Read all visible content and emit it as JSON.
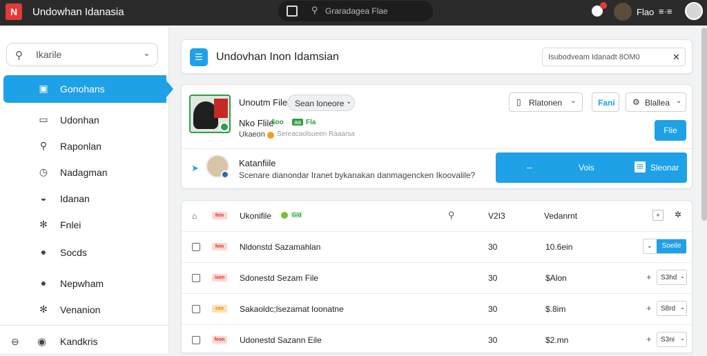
{
  "app": {
    "title": "Undowhan Idanasia",
    "logo_glyph": "N"
  },
  "topbar": {
    "search_label": "Graradagea Flae",
    "user_label": "Flao",
    "menu_label": "≡·≡",
    "notification_count": "!"
  },
  "sidebar": {
    "search_label": "Ikarile",
    "items": [
      {
        "label": "Gonohans",
        "icon": "image-icon",
        "glyph": "▣"
      },
      {
        "label": "Udonhan",
        "icon": "inbox-icon",
        "glyph": "▭"
      },
      {
        "label": "Raponlan",
        "icon": "user-search-icon",
        "glyph": "⚲"
      },
      {
        "label": "Nadagman",
        "icon": "clock-icon",
        "glyph": "◷"
      },
      {
        "label": "Idanan",
        "icon": "mask-icon",
        "glyph": "◒"
      },
      {
        "label": "Fnlei",
        "icon": "gear-icon",
        "glyph": "✻"
      },
      {
        "label": "Socds",
        "icon": "globe-icon",
        "glyph": "●"
      },
      {
        "label": "Nepwham",
        "icon": "info-icon",
        "glyph": "●"
      },
      {
        "label": "Venanion",
        "icon": "settings-icon",
        "glyph": "✻"
      }
    ],
    "footer_label": "Kandkris"
  },
  "header_card": {
    "title": "Undovhan Inon Idamsian",
    "search_placeholder": "Isubodveam Idanadt 8OM0"
  },
  "profile_card": {
    "name": "Unoutm File",
    "select_value": "Sean loneore",
    "sub_title": "Nko Flile",
    "sub_tag1": "$oo",
    "sub_tag2": "aa",
    "sub_tag3": "Fla",
    "meta_label": "Ukaeon",
    "meta_note": "Sereacaolsueen Raaarsa",
    "btn_notice": "Rlatonen",
    "btn_fai": "Fani",
    "btn_gallery": "Blallea",
    "btn_file": "Flie",
    "k_name": "Katanfiile",
    "k_desc": "Scenare dianondar Iranet bykanakan danmagencken Ikoovalile?",
    "blue_dash": "–",
    "blue_vo": "Vois",
    "blue_sb": "Sleonar"
  },
  "table": {
    "header": {
      "title": "Ukonifile",
      "tag": "G/d",
      "col_ver": "V2I3",
      "col_amt": "Vedanrnt"
    },
    "rows": [
      {
        "tag": "fein",
        "tag_color": "red",
        "name": "Nldonstd Sazamahlan",
        "num": "30",
        "amt": "10.6ein",
        "dd_label": "Soeile"
      },
      {
        "tag": "ison",
        "tag_color": "red",
        "name": "Sdonestd Sezam File",
        "num": "30",
        "amt": "$Alon",
        "dd_label": "S3hd"
      },
      {
        "tag": "ceo",
        "tag_color": "orange",
        "name": "Sakaoldc;lsezamat Ioonatne",
        "num": "30",
        "amt": "$.8im",
        "dd_label": "S8rd"
      },
      {
        "tag": "feon",
        "tag_color": "red",
        "name": "Udonestd Sazann Eile",
        "num": "30",
        "amt": "$2.mn",
        "dd_label": "S3ni"
      }
    ]
  },
  "colors": {
    "accent": "#1ea1e6",
    "brand": "#e53935",
    "success": "#2f9e44",
    "topbar": "#2b2b2b"
  }
}
